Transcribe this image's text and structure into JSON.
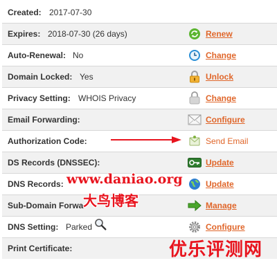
{
  "rows": [
    {
      "label": "Created:",
      "value": "2017-07-30",
      "action": ""
    },
    {
      "label": "Expires:",
      "value": "2018-07-30 (26 days)",
      "action": "Renew",
      "icon": "renew-icon"
    },
    {
      "label": "Auto-Renewal:",
      "value": "No",
      "action": "Change",
      "icon": "clock-icon"
    },
    {
      "label": "Domain Locked:",
      "value": "Yes",
      "action": "Unlock",
      "icon": "padlock-icon"
    },
    {
      "label": "Privacy Setting:",
      "value": "WHOIS Privacy",
      "action": "Change",
      "icon": "privacy-icon"
    },
    {
      "label": "Email Forwarding:",
      "value": "",
      "action": "Configure",
      "icon": "envelope-icon"
    },
    {
      "label": "Authorization Code:",
      "value": "",
      "action": "Send Email",
      "icon": "email-send-icon"
    },
    {
      "label": "DS Records (DNSSEC):",
      "value": "",
      "action": "Update",
      "icon": "key-icon"
    },
    {
      "label": "DNS Records:",
      "value": "",
      "action": "Update",
      "icon": "globe-icon"
    },
    {
      "label": "Sub-Domain Forwa",
      "value": "",
      "action": "Manage",
      "icon": "arrow-right-icon"
    },
    {
      "label": "DNS Setting:",
      "value": "Parked",
      "action": "Configure",
      "icon": "gear-icon"
    },
    {
      "label": "Print Certificate:",
      "value": "",
      "action": "",
      "icon": ""
    }
  ],
  "watermark": {
    "url": "www.daniao.org",
    "name": "大鸟博客",
    "corner": "优乐评测网"
  },
  "colors": {
    "action": "#e0662a",
    "watermark": "#e8141e",
    "annotation_arrow": "#e8141e"
  }
}
